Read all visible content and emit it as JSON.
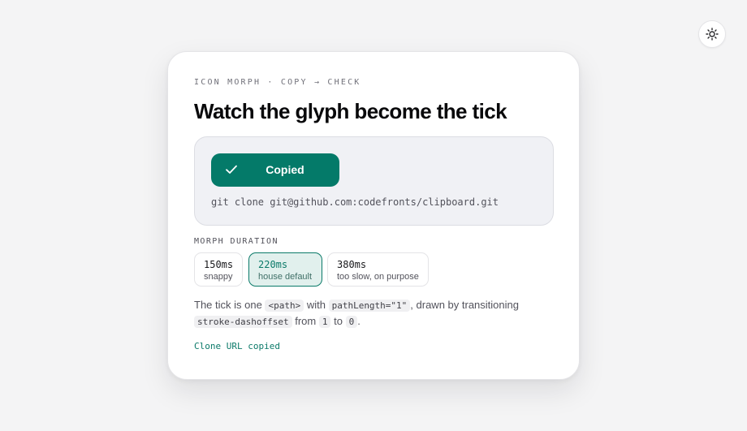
{
  "theme_toggle": {
    "icon": "sun-icon"
  },
  "card": {
    "eyebrow": "ICON MORPH · COPY → CHECK",
    "title": "Watch the glyph become the tick",
    "demo": {
      "button_label": "Copied",
      "button_icon": "check-icon",
      "button_color": "#047a69",
      "command": "git clone git@github.com:codefronts/clipboard.git"
    },
    "duration": {
      "label": "MORPH DURATION",
      "options": [
        {
          "value": "150ms",
          "note": "snappy",
          "selected": false
        },
        {
          "value": "220ms",
          "note": "house default",
          "selected": true
        },
        {
          "value": "380ms",
          "note": "too slow, on purpose",
          "selected": false
        }
      ]
    },
    "description": {
      "t1": "The tick is one",
      "c1": "<path>",
      "t2": "with",
      "c2": "pathLength=\"1\"",
      "t3": ", drawn by transitioning",
      "c3": "stroke-dashoffset",
      "t4": "from",
      "c4": "1",
      "t5": "to",
      "c5": "0",
      "t6": "."
    },
    "status": "Clone URL copied"
  },
  "colors": {
    "accent": "#047a69",
    "background": "#f4f4f5"
  }
}
